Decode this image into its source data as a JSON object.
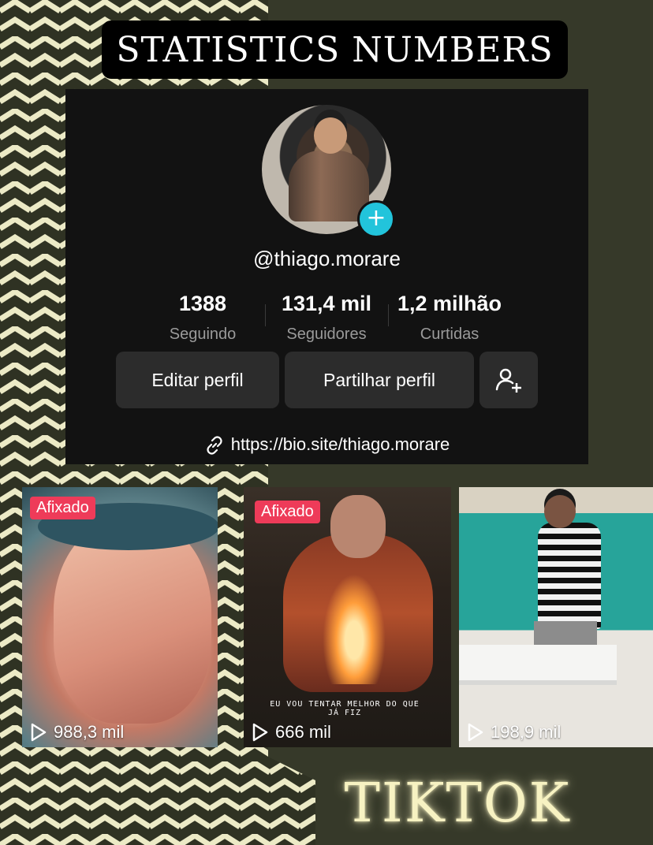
{
  "header": {
    "title": "STATISTICS NUMBERS"
  },
  "profile": {
    "username": "@thiago.morare",
    "stats": [
      {
        "value": "1388",
        "label": "Seguindo"
      },
      {
        "value": "131,4 mil",
        "label": "Seguidores"
      },
      {
        "value": "1,2 milhão",
        "label": "Curtidas"
      }
    ],
    "buttons": {
      "edit": "Editar perfil",
      "share": "Partilhar perfil"
    },
    "link": "https://bio.site/thiago.morare",
    "add_icon": "plus"
  },
  "videos": [
    {
      "badge": "Afixado",
      "views": "988,3 mil"
    },
    {
      "badge": "Afixado",
      "views": "666 mil",
      "caption": "EU VOU TENTAR MELHOR DO QUE JÁ FIZ"
    },
    {
      "badge": "",
      "views": "198,9 mil"
    }
  ],
  "footer": {
    "title": "TIKTOK"
  },
  "colors": {
    "accent": "#22c4db",
    "badge": "#ee3b59",
    "glow": "#f7f2c2"
  }
}
